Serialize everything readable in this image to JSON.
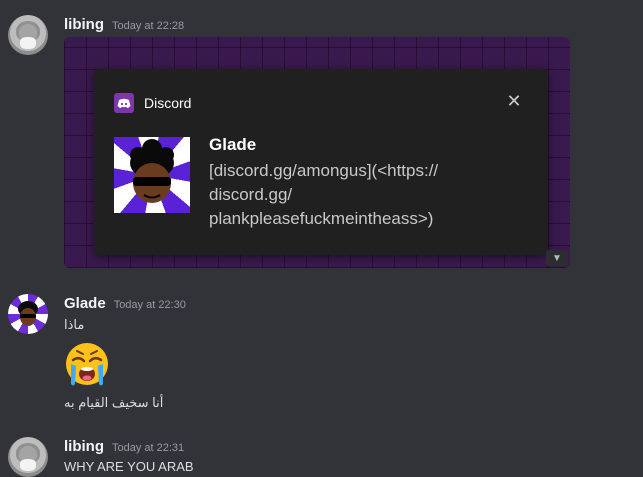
{
  "messages": [
    {
      "author": "libing",
      "timestamp": "Today at 22:28",
      "attachment": {
        "notification": {
          "app_name": "Discord",
          "title": "Glade",
          "body": "[discord.gg/amongus](<https://\ndiscord.gg/\nplankpleasefuckmeintheass>)"
        }
      }
    },
    {
      "author": "Glade",
      "timestamp": "Today at 22:30",
      "line1": "ماذا",
      "emoji_icon": "loudly-crying-face-icon",
      "line2": "أنا سخيف القيام به"
    },
    {
      "author": "libing",
      "timestamp": "Today at 22:31",
      "line1": "WHY ARE YOU ARAB"
    }
  ],
  "colors": {
    "background": "#313338",
    "author_name": "#f2f3f5",
    "timestamp": "#949ba4",
    "accent_purple": "#5b21d6"
  }
}
